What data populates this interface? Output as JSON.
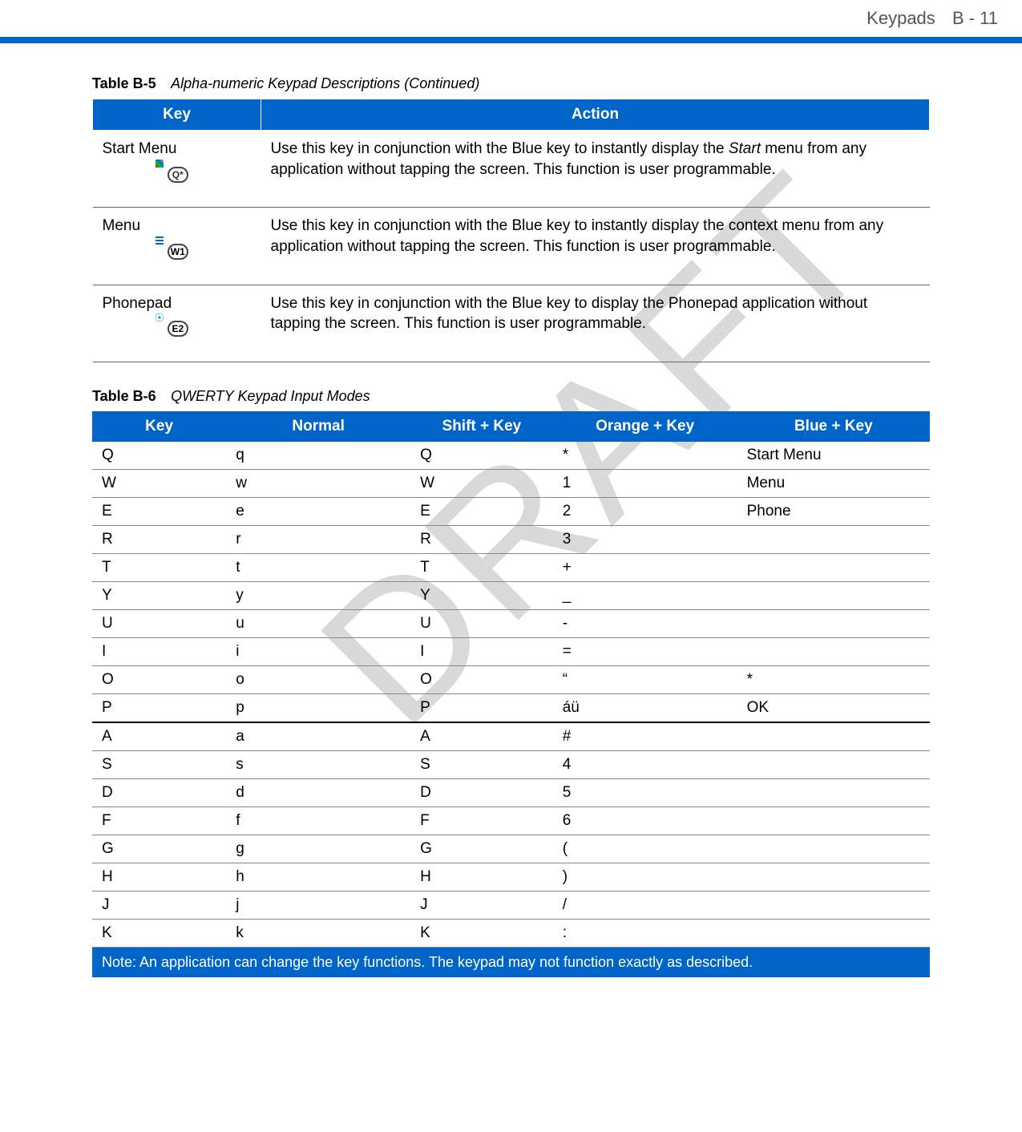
{
  "header": {
    "section": "Keypads",
    "page": "B - 11"
  },
  "watermark": "DRAFT",
  "table5": {
    "caption_bold": "Table B-5",
    "caption_title": "Alpha-numeric Keypad Descriptions (Continued)",
    "headers": [
      "Key",
      "Action"
    ],
    "rows": [
      {
        "key": "Start Menu",
        "icon": "Q*",
        "action_pre": "Use this key in conjunction with the Blue key to instantly display the ",
        "action_em": "Start",
        "action_post": " menu from any application without tapping the screen. This function is user programmable."
      },
      {
        "key": "Menu",
        "icon": "W1",
        "action": "Use this key in conjunction with the Blue key to instantly display the context menu from any application without tapping the screen. This function is user programmable."
      },
      {
        "key": "Phonepad",
        "icon": "E2",
        "action": "Use this key in conjunction with the Blue key to display the Phonepad application without tapping the screen. This function is user programmable."
      }
    ]
  },
  "table6": {
    "caption_bold": "Table B-6",
    "caption_title": "QWERTY Keypad Input Modes",
    "headers": [
      "Key",
      "Normal",
      "Shift + Key",
      "Orange + Key",
      "Blue + Key"
    ],
    "rows": [
      {
        "k": "Q",
        "n": "q",
        "s": "Q",
        "o": "*",
        "b": "Start Menu"
      },
      {
        "k": "W",
        "n": "w",
        "s": "W",
        "o": "1",
        "b": "Menu"
      },
      {
        "k": "E",
        "n": "e",
        "s": "E",
        "o": "2",
        "b": "Phone"
      },
      {
        "k": "R",
        "n": "r",
        "s": "R",
        "o": "3",
        "b": ""
      },
      {
        "k": "T",
        "n": "t",
        "s": "T",
        "o": "+",
        "b": ""
      },
      {
        "k": "Y",
        "n": "y",
        "s": "Y",
        "o": "_",
        "b": ""
      },
      {
        "k": "U",
        "n": "u",
        "s": "U",
        "o": "-",
        "b": ""
      },
      {
        "k": "I",
        "n": "i",
        "s": "I",
        "o": "=",
        "b": ""
      },
      {
        "k": "O",
        "n": "o",
        "s": "O",
        "o": "“",
        "b": "*"
      },
      {
        "k": "P",
        "n": "p",
        "s": "P",
        "o": "áü",
        "b": "OK",
        "hr2": true
      },
      {
        "k": "A",
        "n": "a",
        "s": "A",
        "o": "#",
        "b": ""
      },
      {
        "k": "S",
        "n": "s",
        "s": "S",
        "o": "4",
        "b": ""
      },
      {
        "k": "D",
        "n": "d",
        "s": "D",
        "o": "5",
        "b": ""
      },
      {
        "k": "F",
        "n": "f",
        "s": "F",
        "o": "6",
        "b": ""
      },
      {
        "k": "G",
        "n": "g",
        "s": "G",
        "o": "(",
        "b": ""
      },
      {
        "k": "H",
        "n": "h",
        "s": "H",
        "o": ")",
        "b": ""
      },
      {
        "k": "J",
        "n": "j",
        "s": "J",
        "o": "/",
        "b": ""
      },
      {
        "k": "K",
        "n": "k",
        "s": "K",
        "o": ":",
        "b": ""
      }
    ],
    "note": "Note: An application can change the key functions. The keypad may not function exactly as described."
  }
}
